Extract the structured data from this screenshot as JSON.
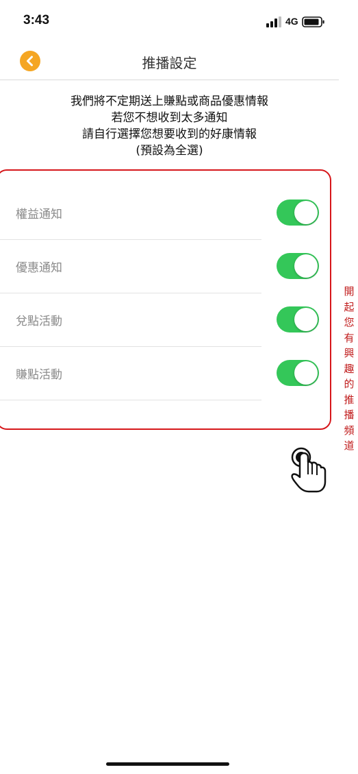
{
  "status_bar": {
    "time": "3:43",
    "network": "4G",
    "signal_icon": "cellular-signal-icon",
    "battery_icon": "battery-icon"
  },
  "header": {
    "title": "推播設定",
    "back_icon": "chevron-left-icon",
    "back_color": "#f5a623"
  },
  "intro": {
    "lines": [
      "我們將不定期送上賺點或商品優惠情報",
      "若您不想收到太多通知",
      "請自行選擇您想要收到的好康情報",
      "(預設為全選)"
    ]
  },
  "settings": [
    {
      "label": "權益通知",
      "enabled": true
    },
    {
      "label": "優惠通知",
      "enabled": true
    },
    {
      "label": "兌點活動",
      "enabled": true
    },
    {
      "label": "賺點活動",
      "enabled": true
    }
  ],
  "toggle_on_color": "#34c759",
  "annotation": {
    "text": "開起您有興趣的推播頻道",
    "color": "#d6161a",
    "icon": "tap-hand-icon"
  }
}
